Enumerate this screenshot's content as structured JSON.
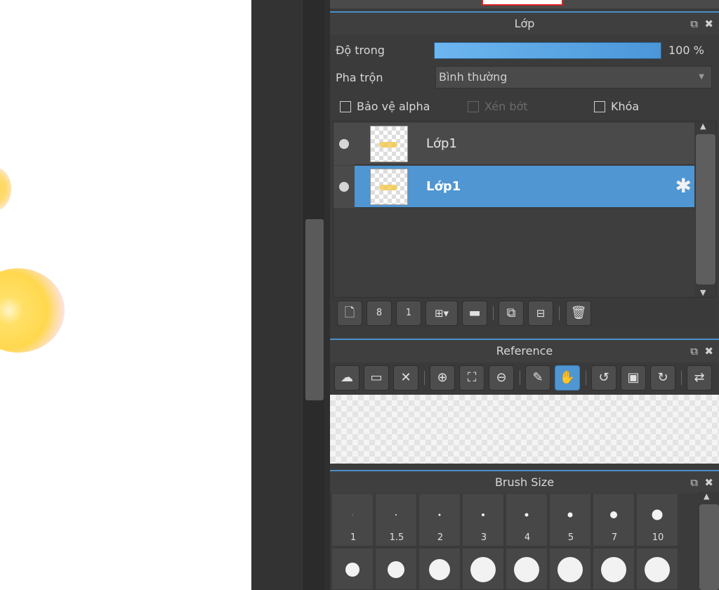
{
  "layer_panel": {
    "title": "Lớp",
    "opacity_label": "Độ trong",
    "opacity_value": "100 %",
    "opacity_fraction": 1.0,
    "blend_label": "Pha trộn",
    "blend_value": "Bình thường",
    "protect_alpha_label": "Bảo vệ alpha",
    "clipping_label": "Xén bớt",
    "lock_label": "Khóa",
    "layers": [
      {
        "name": "Lớp1",
        "selected": false
      },
      {
        "name": "Lớp1",
        "selected": true
      }
    ],
    "toolbar_icons": [
      "new-layer-icon",
      "new-8bit-layer-icon",
      "new-1bit-layer-icon",
      "add-layer-menu-icon",
      "folder-icon",
      "duplicate-layer-icon",
      "merge-layer-icon",
      "trash-icon"
    ]
  },
  "reference_panel": {
    "title": "Reference",
    "toolbar_icons": [
      "upload-icon",
      "open-folder-icon",
      "close-icon",
      "zoom-in-icon",
      "fit-icon",
      "zoom-out-icon",
      "eyedropper-icon",
      "hand-icon",
      "rotate-left-icon",
      "fit-screen-icon",
      "rotate-right-icon",
      "flip-icon"
    ],
    "active_tool": "hand-icon"
  },
  "brush_size_panel": {
    "title": "Brush Size",
    "sizes": [
      "1",
      "1.5",
      "2",
      "3",
      "4",
      "5",
      "7",
      "10"
    ]
  },
  "colors": {
    "accent": "#4f96d3",
    "panel_bg": "#3b3b3b",
    "canvas_bg": "#ffffff"
  }
}
